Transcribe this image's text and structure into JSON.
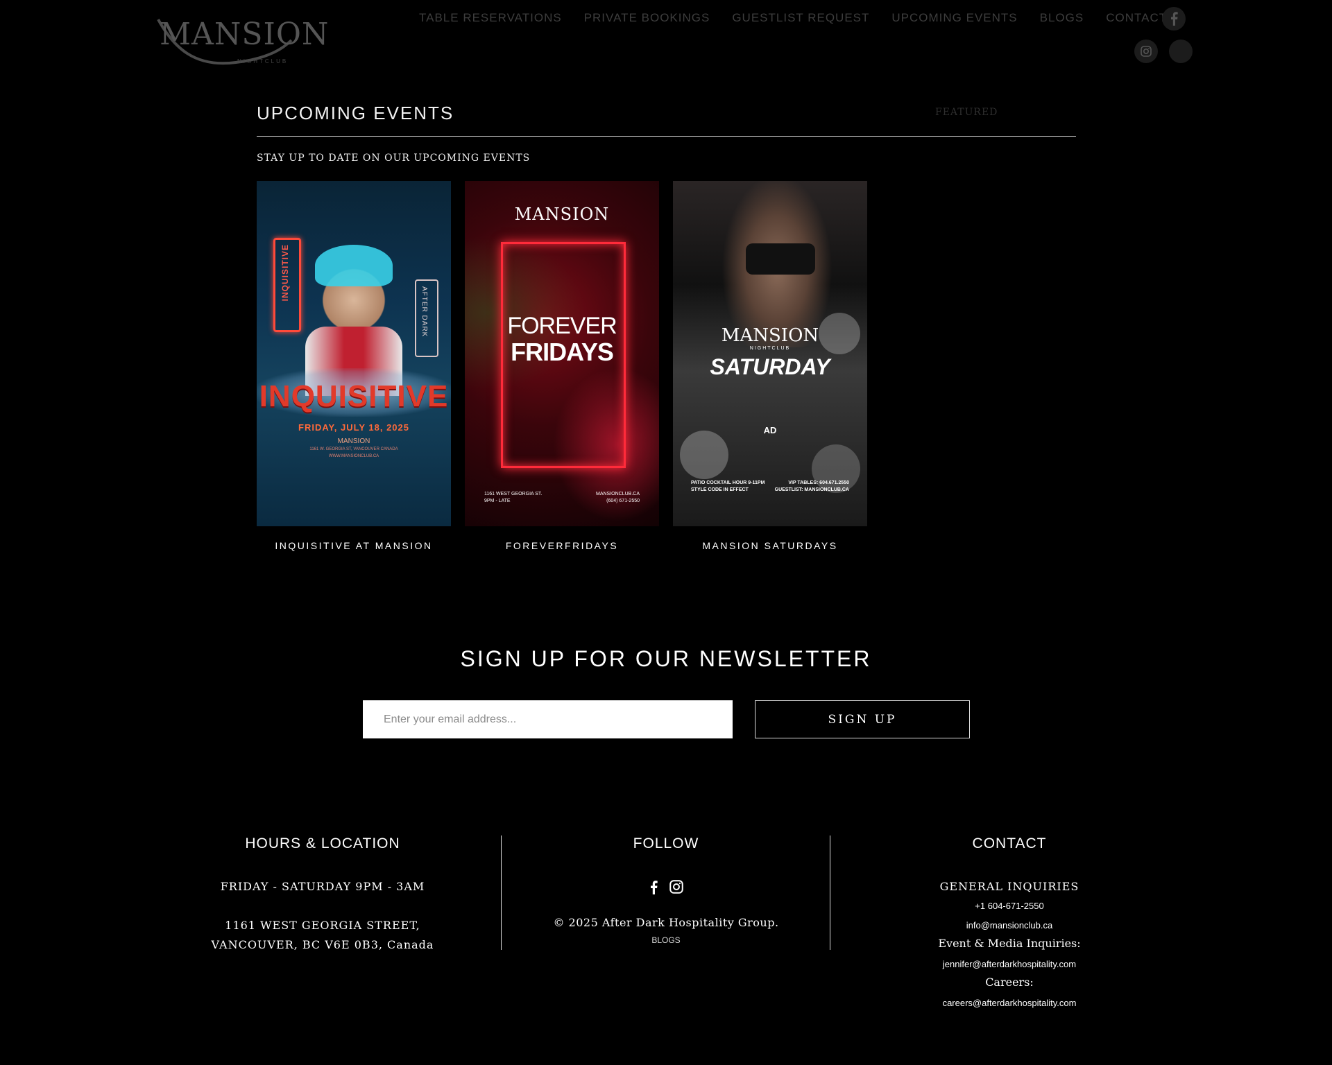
{
  "header": {
    "logo_text": "MANSION",
    "logo_sub": "NIGHTCLUB",
    "nav": [
      "TABLE RESERVATIONS",
      "PRIVATE BOOKINGS",
      "GUESTLIST REQUEST",
      "UPCOMING EVENTS",
      "BLOGS",
      "CONTACT"
    ],
    "social_icons": [
      "facebook-icon",
      "instagram-icon",
      "x-icon"
    ]
  },
  "events": {
    "title": "UPCOMING EVENTS",
    "featured_label": "FEATURED",
    "subtitle": "STAY UP TO DATE ON OUR UPCOMING EVENTS",
    "cards": [
      {
        "caption": "INQUISITIVE AT MANSION",
        "poster_title": "INQUISITIVE",
        "poster_date": "FRIDAY, JULY 18, 2025",
        "poster_brand": "MANSION",
        "poster_address": "1161 W. GEORGIA ST, VANCOUVER CANADA",
        "poster_url": "WWW.MANSIONCLUB.CA",
        "side_left": "INQUISITIVE",
        "side_right": "AFTER DARK"
      },
      {
        "caption": "FOREVERFRIDAYS",
        "poster_brand": "MANSION",
        "poster_line1": "FOREVER",
        "poster_line2": "FRIDAYS",
        "poster_addr": "1161 WEST GEORGIA ST.",
        "poster_time": "9PM - LATE",
        "poster_web": "MANSIONCLUB.CA",
        "poster_phone": "(604) 671-2550"
      },
      {
        "caption": "MANSION SATURDAYS",
        "poster_brand": "MANSION",
        "poster_sub": "NIGHTCLUB",
        "poster_title": "SATURDAY",
        "poster_ad": "AD",
        "poster_left1": "PATIO COCKTAIL HOUR 9-11PM",
        "poster_left2": "STYLE CODE IN EFFECT",
        "poster_right1": "VIP TABLES: 604.671.2550",
        "poster_right2": "GUESTLIST: MANSIONCLUB.CA"
      }
    ]
  },
  "newsletter": {
    "title": "SIGN UP FOR OUR NEWSLETTER",
    "placeholder": "Enter your email address...",
    "button": "SIGN UP"
  },
  "footer": {
    "hours_title": "HOURS & LOCATION",
    "hours": "FRIDAY - SATURDAY 9PM - 3AM",
    "address1": "1161 WEST GEORGIA STREET,",
    "address2": "VANCOUVER, BC V6E 0B3, Canada",
    "follow_title": "FOLLOW",
    "copyright": "© 2025 After Dark Hospitality Group.",
    "blogs_link": "BLOGS",
    "contact_title": "CONTACT",
    "general_label": "GENERAL INQUIRIES",
    "phone": "+1 604-671-2550",
    "info_email": "info@mansionclub.ca",
    "media_label": "Event & Media Inquiries:",
    "media_email": "jennifer@afterdarkhospitality.com",
    "careers_label": "Careers:",
    "careers_email": "careers@afterdarkhospitality.com"
  },
  "colors": {
    "background": "#000000",
    "text": "#ffffff",
    "nav_dim": "#3d3d3d",
    "neon_red": "#ff2b3a"
  }
}
